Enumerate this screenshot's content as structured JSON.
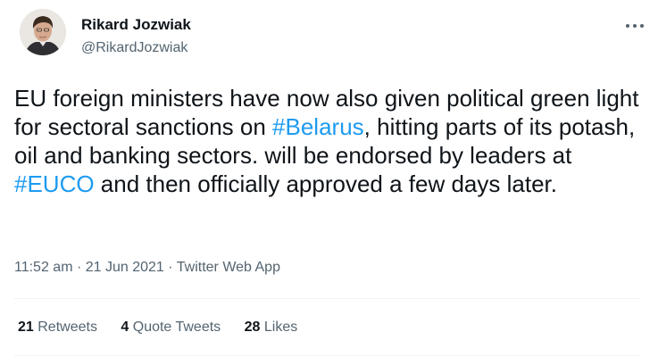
{
  "author": {
    "name": "Rikard Jozwiak",
    "handle": "@RikardJozwiak"
  },
  "more_icon": "more-horizontal-icon",
  "tweet": {
    "seg1": "EU foreign ministers have now also given political green light for sectoral sanctions on ",
    "hashtag1": "#Belarus",
    "seg2": ", hitting parts of its potash, oil and banking sectors. will be endorsed by leaders at ",
    "hashtag2": "#EUCO",
    "seg3": " and then officially approved a few days later."
  },
  "meta": {
    "time": "11:52 am",
    "sep1": " · ",
    "date": "21 Jun 2021",
    "sep2": " · ",
    "source": "Twitter Web App"
  },
  "stats": {
    "retweets_count": "21",
    "retweets_label": " Retweets",
    "quotes_count": "4",
    "quotes_label": " Quote Tweets",
    "likes_count": "28",
    "likes_label": " Likes"
  },
  "colors": {
    "link": "#1d9bf0",
    "secondary": "#536471",
    "primary": "#0f1419"
  }
}
